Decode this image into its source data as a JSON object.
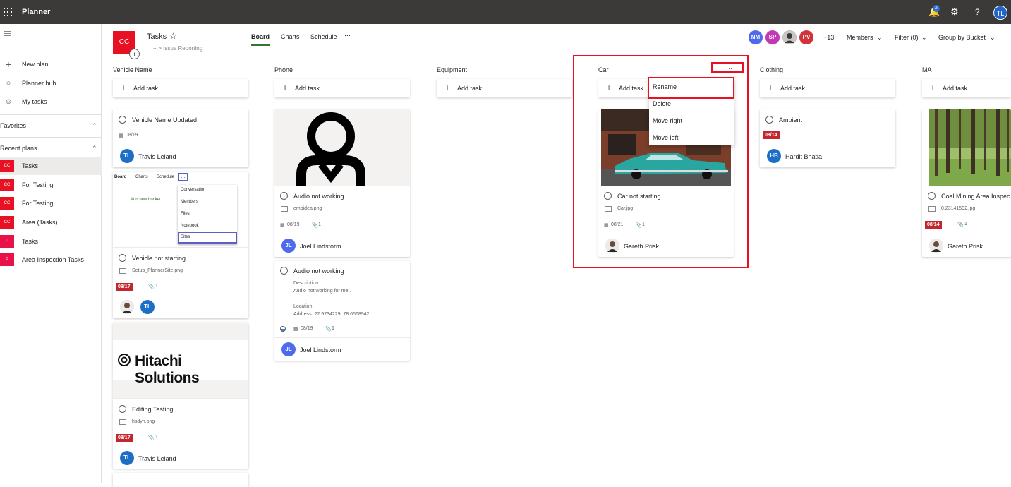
{
  "app": {
    "name": "Planner",
    "notification_count": "2",
    "user_initials": "TL"
  },
  "left_nav": {
    "items": [
      {
        "label": "New plan",
        "icon": "plus-icon"
      },
      {
        "label": "Planner hub",
        "icon": "circle-icon"
      },
      {
        "label": "My tasks",
        "icon": "person-icon"
      }
    ],
    "favorites_label": "Favorites",
    "recent_label": "Recent plans",
    "plans": [
      {
        "badge": "CC",
        "label": "Tasks",
        "color": "#e81123"
      },
      {
        "badge": "CC",
        "label": "For Testing",
        "color": "#e81123"
      },
      {
        "badge": "CC",
        "label": "For Testing",
        "color": "#e81123"
      },
      {
        "badge": "CC",
        "label": "Area (Tasks)",
        "color": "#e81123"
      },
      {
        "badge": "P",
        "label": "Tasks",
        "color": "#e8114a"
      },
      {
        "badge": "P",
        "label": "Area Inspection Tasks",
        "color": "#e8114a"
      }
    ]
  },
  "header": {
    "logo": "CC",
    "info": "i",
    "title": "Tasks",
    "breadcrumb": "⋯  > Issue Reporting",
    "tabs": [
      "Board",
      "Charts",
      "Schedule"
    ],
    "more": "⋯",
    "members": [
      {
        "initials": "NM",
        "color": "#4f6bed"
      },
      {
        "initials": "SP",
        "color": "#c239b3"
      },
      {
        "initials": "",
        "color": "#8a8886"
      },
      {
        "initials": "PV",
        "color": "#d13438"
      }
    ],
    "more_members": "+13",
    "members_label": "Members",
    "filter_label": "Filter (0)",
    "group_label": "Group by Bucket"
  },
  "add_task_label": "Add task",
  "columns": [
    {
      "name": "Vehicle Name"
    },
    {
      "name": "Phone"
    },
    {
      "name": "Equipment"
    },
    {
      "name": "Car",
      "more": "⋯"
    },
    {
      "name": "Clothing"
    },
    {
      "name": "MA"
    }
  ],
  "cards": {
    "vehicle_updated": {
      "title": "Vehicle Name Updated",
      "date": "08/19",
      "assignee_initials": "TL",
      "assignee": "Travis Leland"
    },
    "vehicle_not_starting": {
      "preview": {
        "tabs": [
          "Board",
          "Charts",
          "Schedule"
        ],
        "add_bucket": "Add new bucket",
        "menu": [
          "Conversation",
          "Members",
          "Files",
          "Notebook",
          "Sites"
        ]
      },
      "title": "Vehicle not starting",
      "file": "Setup_PlannerSite.png",
      "due": "08/17",
      "attachments": "1",
      "assignee_initials": "TL"
    },
    "editing_testing": {
      "image_text": "Hitachi Solutions",
      "title": "Editing Testing",
      "file": "hsdyn.png",
      "due": "08/17",
      "attachments": "1",
      "assignee_initials": "TL",
      "assignee": "Travis Leland"
    },
    "audio_1": {
      "title": "Audio not working",
      "file": "empidea.png",
      "date": "08/19",
      "attachments": "1",
      "assignee_initials": "JL",
      "assignee": "Joel Lindstorm"
    },
    "audio_2": {
      "title": "Audio not working",
      "desc_lines": [
        "Description:",
        "Audio not working for me..",
        "",
        "Location:",
        "Address: 22.9734229, 78.6568942"
      ],
      "date": "08/19",
      "attachments": "1",
      "assignee_initials": "JL",
      "assignee": "Joel Lindstorm"
    },
    "car": {
      "title": "Car not starting",
      "file": "Car.jpg",
      "date": "08/21",
      "attachments": "1",
      "assignee": "Gareth Prisk"
    },
    "ambient": {
      "title": "Ambient",
      "due": "08/14",
      "assignee_initials": "HB",
      "assignee": "Hardit Bhatia"
    },
    "coal": {
      "title": "Coal Mining Area Inspec",
      "file": "0.23141592.jpg",
      "due": "08/14",
      "attachments": "1",
      "assignee": "Gareth Prisk"
    }
  },
  "bucket_menu": [
    "Rename",
    "Delete",
    "Move right",
    "Move left"
  ]
}
